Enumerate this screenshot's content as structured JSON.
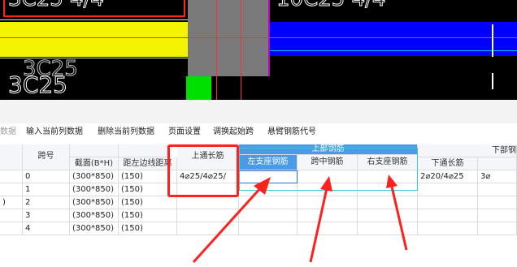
{
  "cad": {
    "top_texts": [
      "3C25  4/4",
      "10C25  4/4"
    ],
    "label_large": "3C25",
    "label_large_echo": "3C25"
  },
  "toolbar": {
    "items": [
      "数据",
      "输入当前列数据",
      "删除当前列数据",
      "页面设置",
      "调换起始跨",
      "悬臂钢筋代号"
    ]
  },
  "table": {
    "headers": {
      "span": "跨号",
      "section": "截面(B*H)",
      "edge_dist": "距左边线距离",
      "top_through": "上通长筋",
      "top_rebar_group": "上部钢筋",
      "left_support": "左支座钢筋",
      "mid_span": "跨中钢筋",
      "right_support": "右支座钢筋",
      "bottom_group": "下部钢",
      "bottom_through": "下通长筋"
    },
    "rows": [
      {
        "lead": "",
        "span": "0",
        "section": "(300*850)",
        "edge": "(150)",
        "top_through": "4⌀25/4⌀25/",
        "bottom_through": "2⌀20/4⌀25",
        "extra": "3⌀"
      },
      {
        "lead": "",
        "span": "1",
        "section": "(300*850)",
        "edge": "(150)",
        "top_through": "",
        "bottom_through": "",
        "extra": ""
      },
      {
        "lead": ")",
        "span": "2",
        "section": "(300*850)",
        "edge": "(150)",
        "top_through": "",
        "bottom_through": "",
        "extra": ""
      },
      {
        "lead": "",
        "span": "3",
        "section": "(300*850)",
        "edge": "(150)",
        "top_through": "",
        "bottom_through": "",
        "extra": ""
      },
      {
        "lead": "",
        "span": "4",
        "section": "(300*850)",
        "edge": "(150)",
        "top_through": "",
        "bottom_through": "",
        "extra": ""
      }
    ]
  },
  "colors": {
    "annotation_red": "#ff2020",
    "cad_yellow": "#f4f400",
    "cad_blue": "#0000ff",
    "cad_green": "#00e000",
    "cad_grey": "#7a7a7a",
    "header_blue": "#4a9ae6"
  }
}
